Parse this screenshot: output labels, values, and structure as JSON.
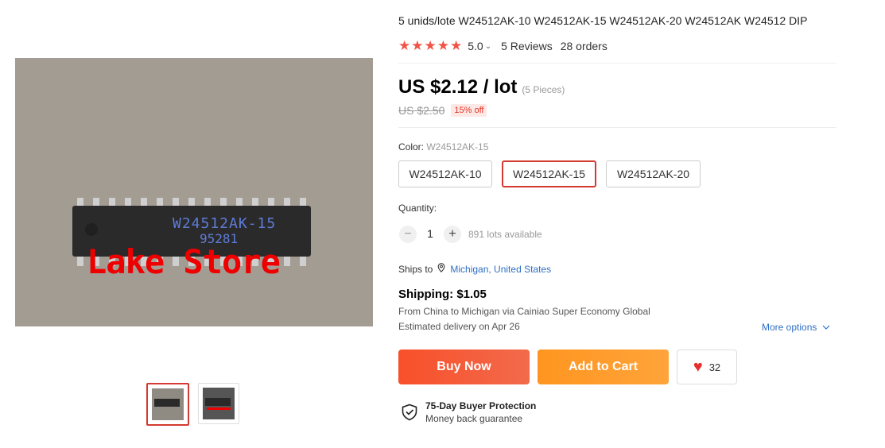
{
  "gallery": {
    "chip_text_line1": "W24512AK-15",
    "chip_text_line2": "95281",
    "watermark": "Lake Store",
    "thumbnails": [
      "thumbnail-1",
      "thumbnail-2"
    ],
    "active_thumbnail": 0
  },
  "product": {
    "title": "5 unids/lote W24512AK-10 W24512AK-15 W24512AK-20 W24512AK W24512 DIP",
    "rating": "5.0",
    "reviews": "5 Reviews",
    "orders": "28 orders",
    "price": "US $2.12 / lot",
    "pieces": "(5 Pieces)",
    "old_price": "US $2.50",
    "discount": "15% off"
  },
  "color": {
    "label": "Color: ",
    "selected_value": "W24512AK-15",
    "options": [
      "W24512AK-10",
      "W24512AK-15",
      "W24512AK-20"
    ],
    "selected_index": 1
  },
  "quantity": {
    "label": "Quantity:",
    "value": "1",
    "minus": "−",
    "plus": "+",
    "available": "891 lots available"
  },
  "shipping": {
    "ships_to_label": "Ships to",
    "location": "Michigan, United States",
    "price": "Shipping: $1.05",
    "route": "From China to Michigan via Cainiao Super Economy Global",
    "estimate": "Estimated delivery on Apr 26",
    "more_options": "More options"
  },
  "actions": {
    "buy_now": "Buy Now",
    "add_to_cart": "Add to Cart",
    "wishlist_count": "32"
  },
  "protection": {
    "title": "75-Day Buyer Protection",
    "subtitle": "Money back guarantee"
  },
  "colors": {
    "star": "#f05446",
    "buy_now": "#f8502a",
    "add_to_cart": "#ff9520",
    "link": "#2f6fc4",
    "selected_border": "#d43a2f"
  },
  "icons": [
    "star-icon",
    "chevron-down-icon",
    "location-pin-icon",
    "heart-icon",
    "shield-check-icon"
  ]
}
